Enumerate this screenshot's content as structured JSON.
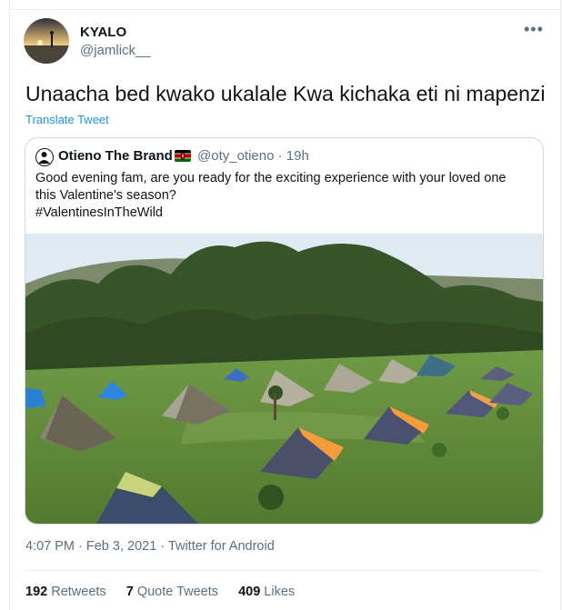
{
  "author": {
    "name": "KYALO",
    "handle": "@jamlick__"
  },
  "more_icon": "more-horizontal-icon",
  "tweet": {
    "text": "Unaacha bed kwako ukalale Kwa kichaka eti ni mapenzi",
    "translate_label": "Translate Tweet"
  },
  "quote": {
    "name": "Otieno The Brand",
    "flag": "kenya-flag-icon",
    "handle": "@oty_otieno",
    "sep": " · ",
    "time": "19h",
    "lines": [
      "Good evening fam, are you ready for the exciting experience with your loved one",
      "this Valentine's season?",
      "#ValentinesInTheWild"
    ]
  },
  "meta": {
    "time": "4:07 PM",
    "sep1": " · ",
    "date": "Feb 3, 2021",
    "sep2": " · ",
    "source": "Twitter for Android"
  },
  "stats": {
    "retweets_count": "192",
    "retweets_label": "Retweets",
    "quotes_count": "7",
    "quotes_label": "Quote Tweets",
    "likes_count": "409",
    "likes_label": "Likes"
  }
}
